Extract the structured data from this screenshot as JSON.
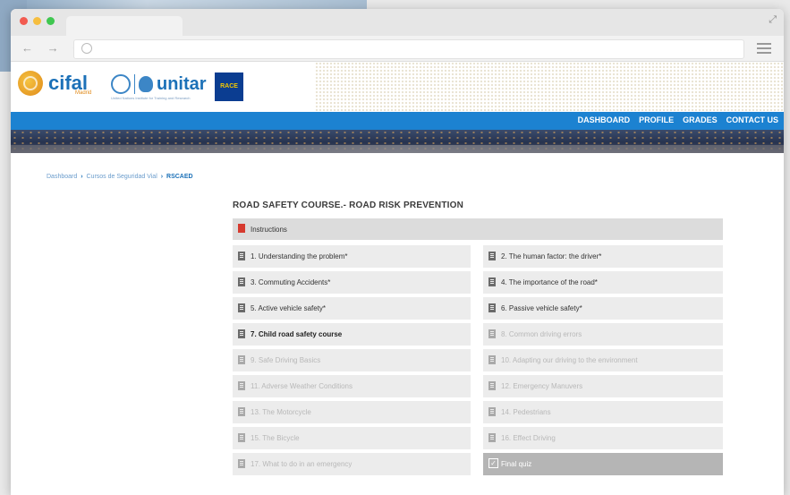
{
  "browser": {
    "url": "",
    "nav": "← → C"
  },
  "logos": {
    "cifal": "cifal",
    "cifal_sub": "Madrid",
    "unitar": "unitar",
    "unitar_sub": "United Nations Institute for Training and Research",
    "race": "RACE"
  },
  "nav": {
    "items": [
      "DASHBOARD",
      "PROFILE",
      "GRADES",
      "CONTACT US"
    ]
  },
  "breadcrumb": {
    "items": [
      "Dashboard",
      "Cursos de Seguridad Vial",
      "RSCAED"
    ],
    "separator": "›"
  },
  "course": {
    "title": "ROAD SAFETY COURSE.- ROAD RISK PREVENTION",
    "instructions_label": "Instructions",
    "modules": [
      {
        "label": "1. Understanding the problem*",
        "state": "normal"
      },
      {
        "label": "2. The human factor: the driver*",
        "state": "normal"
      },
      {
        "label": "3. Commuting Accidents*",
        "state": "normal"
      },
      {
        "label": "4. The importance of the road*",
        "state": "normal"
      },
      {
        "label": "5. Active vehicle safety*",
        "state": "normal"
      },
      {
        "label": "6. Passive vehicle safety*",
        "state": "normal"
      },
      {
        "label": "7. Child road safety course",
        "state": "bold"
      },
      {
        "label": "8. Common driving errors",
        "state": "dim"
      },
      {
        "label": "9. Safe Driving Basics",
        "state": "dim"
      },
      {
        "label": "10. Adapting our driving to the environment",
        "state": "dim"
      },
      {
        "label": "11. Adverse Weather Conditions",
        "state": "dim"
      },
      {
        "label": "12. Emergency Manuvers",
        "state": "dim"
      },
      {
        "label": "13. The Motorcycle",
        "state": "dim"
      },
      {
        "label": "14. Pedestrians",
        "state": "dim"
      },
      {
        "label": "15. The Bicycle",
        "state": "dim"
      },
      {
        "label": "16. Effect Driving",
        "state": "dim"
      },
      {
        "label": "17. What to do in an emergency",
        "state": "dim"
      },
      {
        "label": "Final quiz",
        "state": "quiz"
      }
    ]
  },
  "colors": {
    "accent": "#1c82d1",
    "brand_blue": "#1c71b8",
    "instructions_icon": "#d63a2f"
  }
}
